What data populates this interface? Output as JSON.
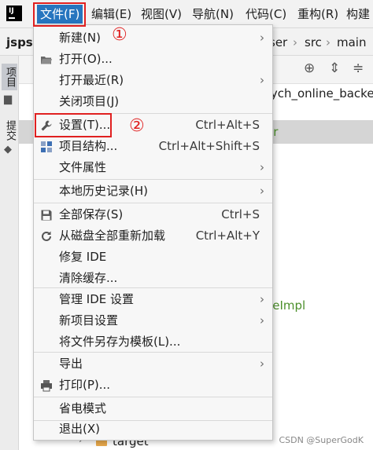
{
  "menubar": {
    "items": [
      {
        "label": "文件(F)"
      },
      {
        "label": "编辑(E)"
      },
      {
        "label": "视图(V)"
      },
      {
        "label": "导航(N)"
      },
      {
        "label": "代码(C)"
      },
      {
        "label": "重构(R)"
      },
      {
        "label": "构建"
      }
    ],
    "annotation_1": "①",
    "annotation_2": "②"
  },
  "breadcrumb": {
    "project": "jspsy",
    "user": "ser",
    "src": "src",
    "main": "main"
  },
  "side_tabs": {
    "project": "项目",
    "commit": "提交"
  },
  "background_text": {
    "line1": "sych_online_backer",
    "line2": "er",
    "line3": "ceImpl",
    "line4": "n",
    "line5": "l",
    "target": "target"
  },
  "file_menu": {
    "items": [
      {
        "label": "新建(N)",
        "icon": "",
        "shortcut": "",
        "submenu": true
      },
      {
        "label": "打开(O)...",
        "icon": "folder-open-icon",
        "shortcut": "",
        "submenu": false
      },
      {
        "label": "打开最近(R)",
        "icon": "",
        "shortcut": "",
        "submenu": true
      },
      {
        "label": "关闭项目(J)",
        "icon": "",
        "shortcut": "",
        "submenu": false
      },
      {
        "label": "设置(T)...",
        "icon": "wrench-icon",
        "shortcut": "Ctrl+Alt+S",
        "submenu": false
      },
      {
        "label": "项目结构...",
        "icon": "project-structure-icon",
        "shortcut": "Ctrl+Alt+Shift+S",
        "submenu": false
      },
      {
        "label": "文件属性",
        "icon": "",
        "shortcut": "",
        "submenu": true
      },
      {
        "label": "本地历史记录(H)",
        "icon": "",
        "shortcut": "",
        "submenu": true
      },
      {
        "label": "全部保存(S)",
        "icon": "save-icon",
        "shortcut": "Ctrl+S",
        "submenu": false
      },
      {
        "label": "从磁盘全部重新加载",
        "icon": "reload-icon",
        "shortcut": "Ctrl+Alt+Y",
        "submenu": false
      },
      {
        "label": "修复 IDE",
        "icon": "",
        "shortcut": "",
        "submenu": false
      },
      {
        "label": "清除缓存...",
        "icon": "",
        "shortcut": "",
        "submenu": false
      },
      {
        "label": "管理 IDE 设置",
        "icon": "",
        "shortcut": "",
        "submenu": true
      },
      {
        "label": "新项目设置",
        "icon": "",
        "shortcut": "",
        "submenu": true
      },
      {
        "label": "将文件另存为模板(L)...",
        "icon": "",
        "shortcut": "",
        "submenu": false
      },
      {
        "label": "导出",
        "icon": "",
        "shortcut": "",
        "submenu": true
      },
      {
        "label": "打印(P)...",
        "icon": "printer-icon",
        "shortcut": "",
        "submenu": false
      },
      {
        "label": "省电模式",
        "icon": "",
        "shortcut": "",
        "submenu": false
      },
      {
        "label": "退出(X)",
        "icon": "",
        "shortcut": "",
        "submenu": false
      }
    ]
  },
  "watermark": "CSDN @SuperGodK"
}
